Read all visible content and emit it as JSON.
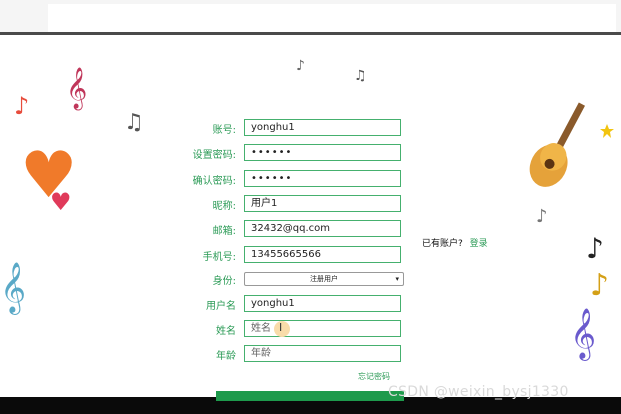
{
  "form": {
    "fields": [
      {
        "label": "账号:",
        "value": "yonghu1",
        "kind": "text"
      },
      {
        "label": "设置密码:",
        "value": "••••••",
        "kind": "password"
      },
      {
        "label": "确认密码:",
        "value": "••••••",
        "kind": "password"
      },
      {
        "label": "昵称:",
        "value": "用户1",
        "kind": "text"
      },
      {
        "label": "邮箱:",
        "value": "32432@qq.com",
        "kind": "text"
      },
      {
        "label": "手机号:",
        "value": "13455665566",
        "kind": "text"
      },
      {
        "label": "身份:",
        "value": "注册用户",
        "kind": "select"
      },
      {
        "label": "用户名",
        "value": "yonghu1",
        "kind": "text"
      },
      {
        "label": "姓名",
        "placeholder": "姓名",
        "kind": "text"
      },
      {
        "label": "年龄",
        "placeholder": "年龄",
        "kind": "text"
      }
    ],
    "have_account": "已有账户?",
    "login_link": "登录",
    "forgot": "忘记密码",
    "cursor_glyph": "I"
  },
  "watermark": "CSDN @weixin_bysj1330",
  "decorations": {
    "treble_clef": "𝄞",
    "eighth_note": "♪",
    "beamed_notes": "♫",
    "heart": "♥"
  },
  "colors": {
    "accent": "#2c9b57",
    "input_border": "#45b06e",
    "submit": "#1e9a4c"
  }
}
